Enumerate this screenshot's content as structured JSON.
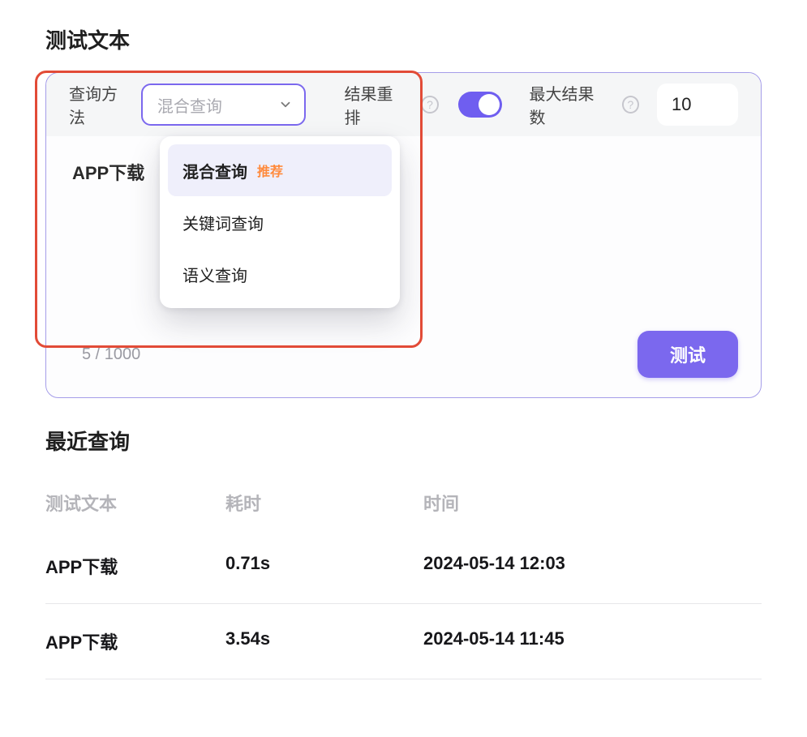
{
  "sections": {
    "test_text_title": "测试文本",
    "recent_title": "最近查询"
  },
  "query_header": {
    "method_label": "查询方法",
    "method_value": "混合查询",
    "rerank_label": "结果重排",
    "rerank_on": true,
    "max_label": "最大结果数",
    "max_value": "10"
  },
  "dropdown": {
    "options": [
      {
        "label": "混合查询",
        "badge": "推荐",
        "selected": true
      },
      {
        "label": "关键词查询",
        "badge": "",
        "selected": false
      },
      {
        "label": "语义查询",
        "badge": "",
        "selected": false
      }
    ]
  },
  "query_body": {
    "text": "APP下载",
    "char_count": "5 / 1000",
    "test_button": "测试"
  },
  "recent": {
    "columns": {
      "text": "测试文本",
      "duration": "耗时",
      "time": "时间"
    },
    "rows": [
      {
        "text": "APP下载",
        "duration": "0.71s",
        "time": "2024-05-14 12:03"
      },
      {
        "text": "APP下载",
        "duration": "3.54s",
        "time": "2024-05-14 11:45"
      }
    ]
  }
}
